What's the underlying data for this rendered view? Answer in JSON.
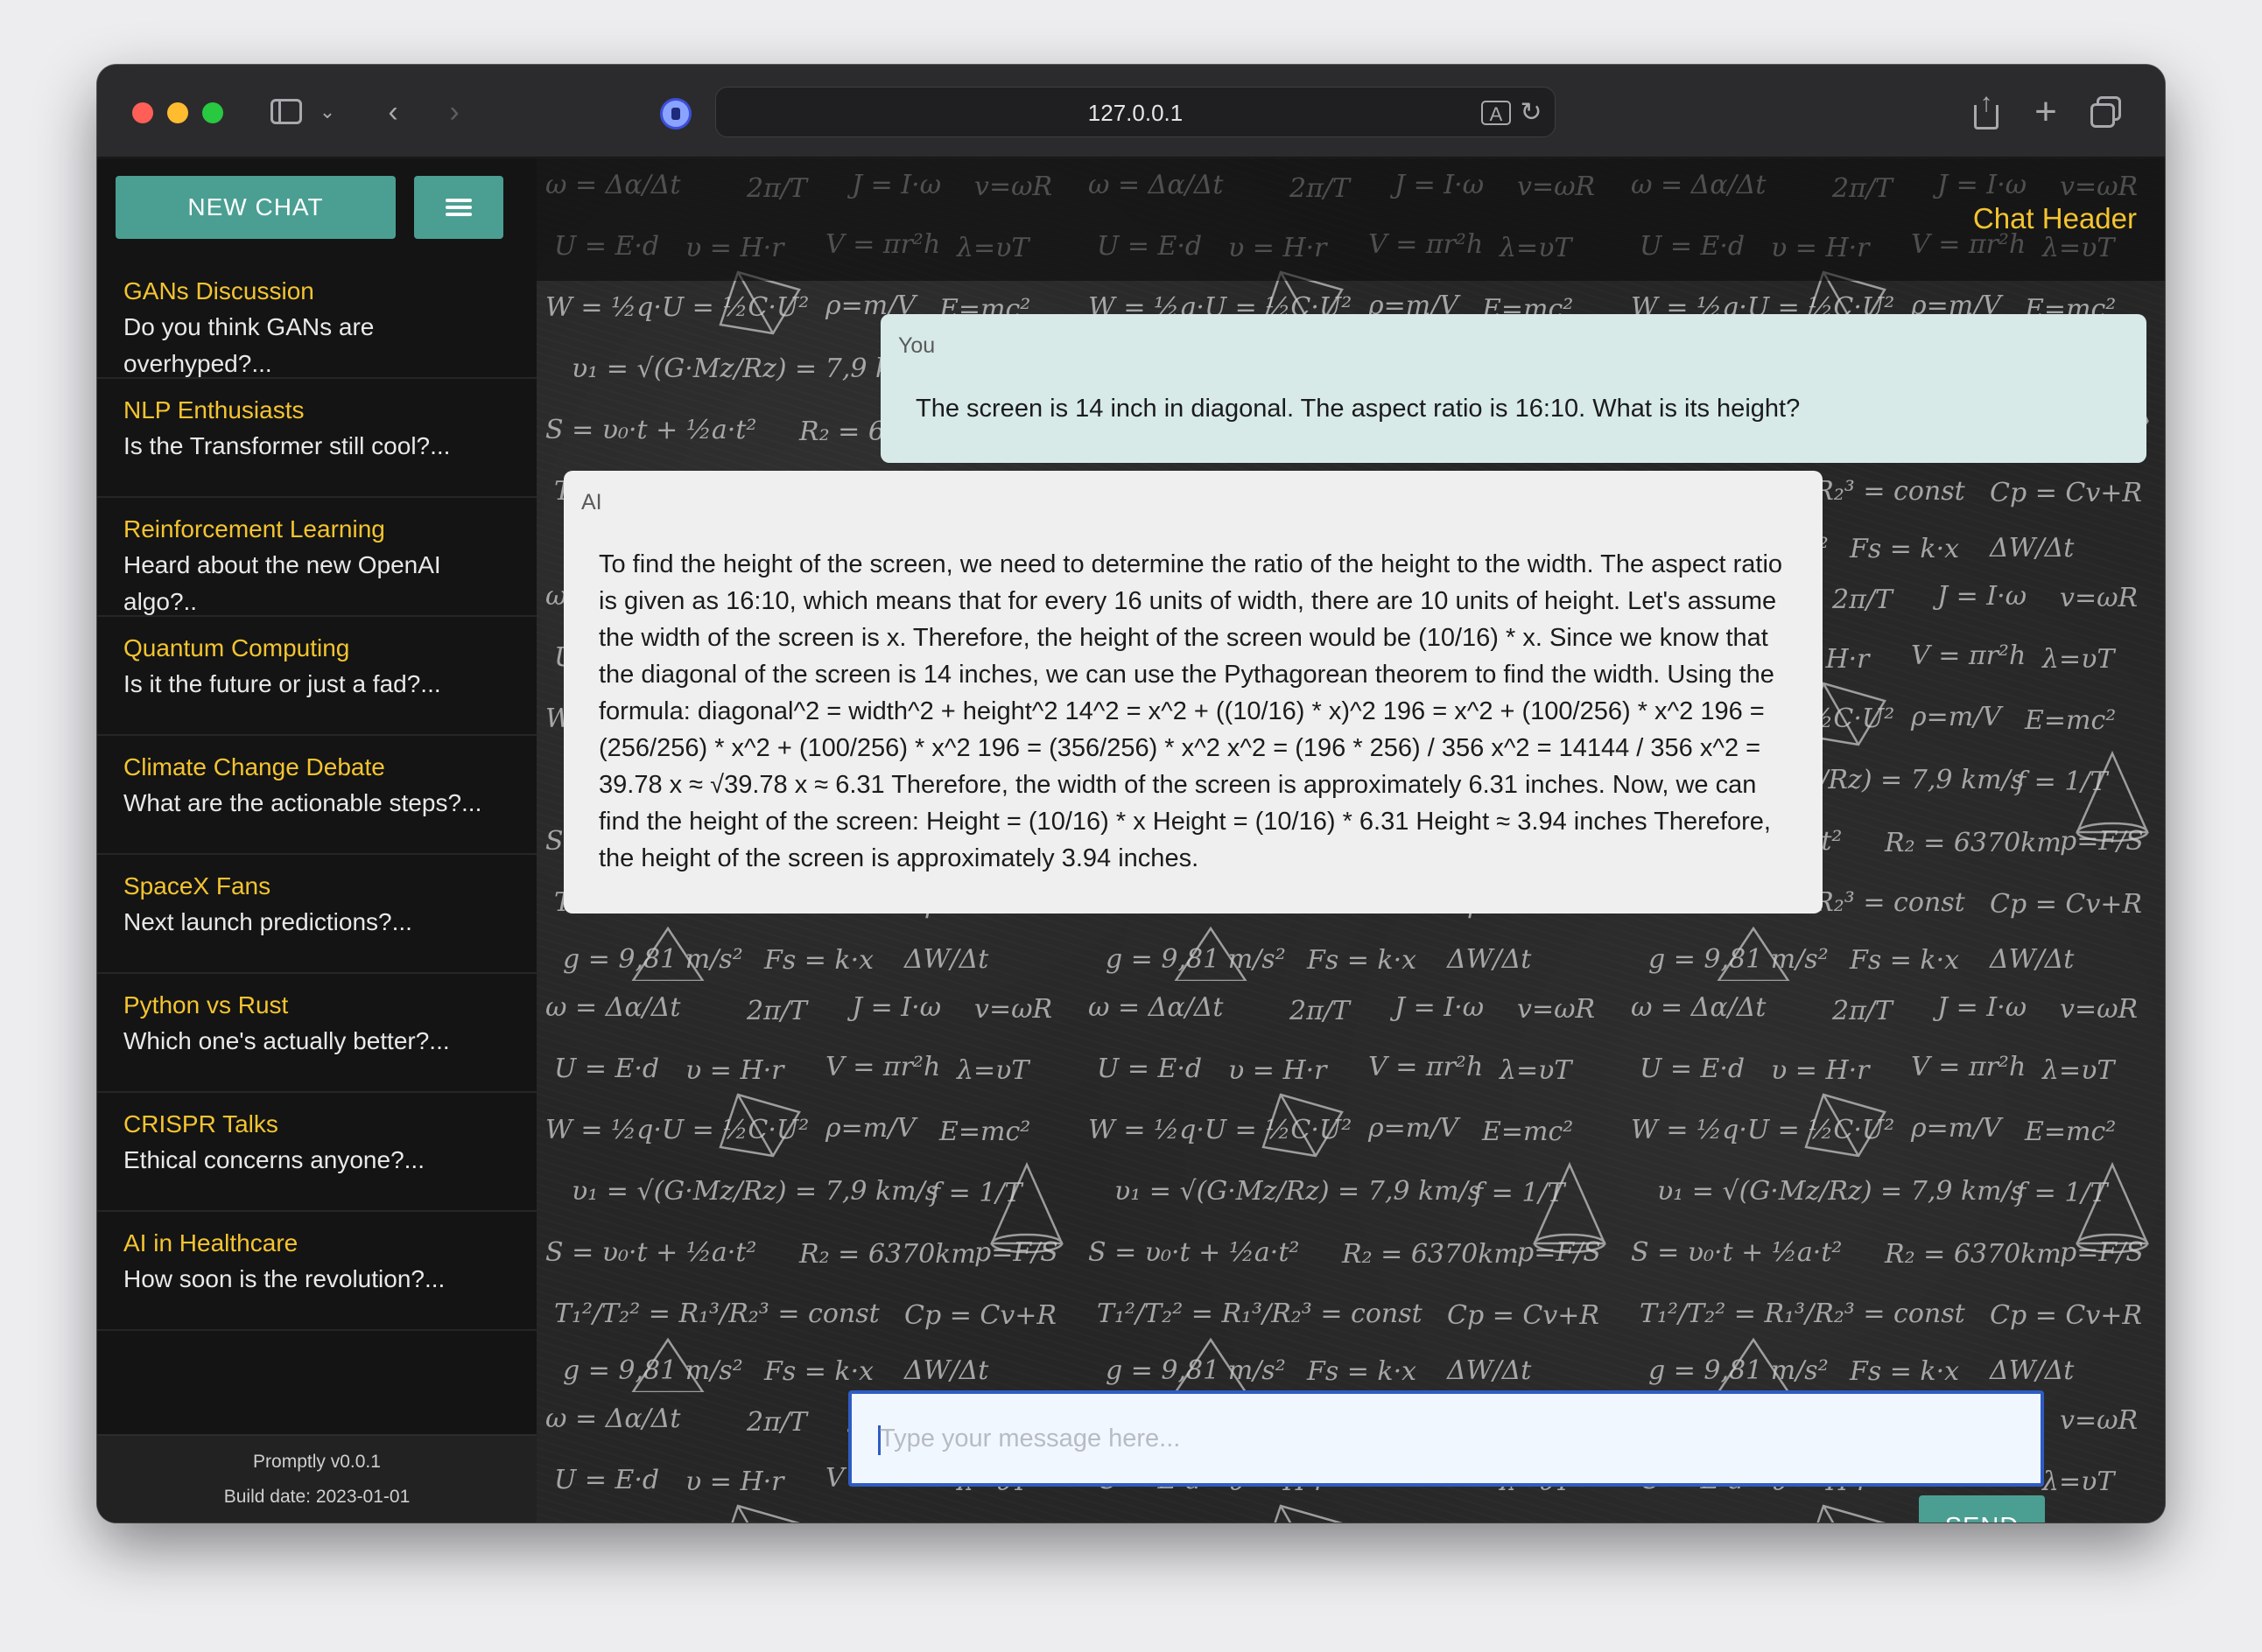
{
  "browser": {
    "url": "127.0.0.1"
  },
  "sidebar": {
    "new_chat_label": "NEW CHAT",
    "chats": [
      {
        "title": "GANs Discussion",
        "preview": "Do you think GANs are overhyped?..."
      },
      {
        "title": "NLP Enthusiasts",
        "preview": "Is the Transformer still cool?..."
      },
      {
        "title": "Reinforcement Learning",
        "preview": "Heard about the new OpenAI algo?.."
      },
      {
        "title": "Quantum Computing",
        "preview": "Is it the future or just a fad?..."
      },
      {
        "title": "Climate Change Debate",
        "preview": "What are the actionable steps?..."
      },
      {
        "title": "SpaceX Fans",
        "preview": "Next launch predictions?..."
      },
      {
        "title": "Python vs Rust",
        "preview": "Which one's actually better?..."
      },
      {
        "title": "CRISPR Talks",
        "preview": "Ethical concerns anyone?..."
      },
      {
        "title": "AI in Healthcare",
        "preview": "How soon is the revolution?..."
      }
    ],
    "footer": {
      "version": "Promptly v0.0.1",
      "build_date": "Build date: 2023-01-01"
    }
  },
  "chat": {
    "header_title": "Chat Header",
    "messages": [
      {
        "sender": "You",
        "text": "The screen is 14 inch in diagonal. The aspect ratio is 16:10. What is its height?"
      },
      {
        "sender": "AI",
        "text": "To find the height of the screen, we need to determine the ratio of the height to the width. The aspect ratio is given as 16:10, which means that for every 16 units of width, there are 10 units of height. Let's assume the width of the screen is x. Therefore, the height of the screen would be (10/16) * x. Since we know that the diagonal of the screen is 14 inches, we can use the Pythagorean theorem to find the width. Using the formula: diagonal^2 = width^2 + height^2 14^2 = x^2 + ((10/16) * x)^2 196 = x^2 + (100/256) * x^2 196 = (256/256) * x^2 + (100/256) * x^2 196 = (356/256) * x^2 x^2 = (196 * 256) / 356 x^2 = 14144 / 356 x^2 = 39.78 x ≈ √39.78 x ≈ 6.31 Therefore, the width of the screen is approximately 6.31 inches. Now, we can find the height of the screen: Height = (10/16) * x Height = (10/16) * 6.31 Height ≈ 3.94 inches Therefore, the height of the screen is approximately 3.94 inches."
      }
    ],
    "input_placeholder": "Type your message here...",
    "input_value": "",
    "send_label": "SEND"
  },
  "colors": {
    "accent": "#4a9f92",
    "title_yellow": "#f4c430",
    "you_bubble": "#d7eae8",
    "ai_bubble": "#efefef",
    "input_border": "#2f5cc4"
  }
}
